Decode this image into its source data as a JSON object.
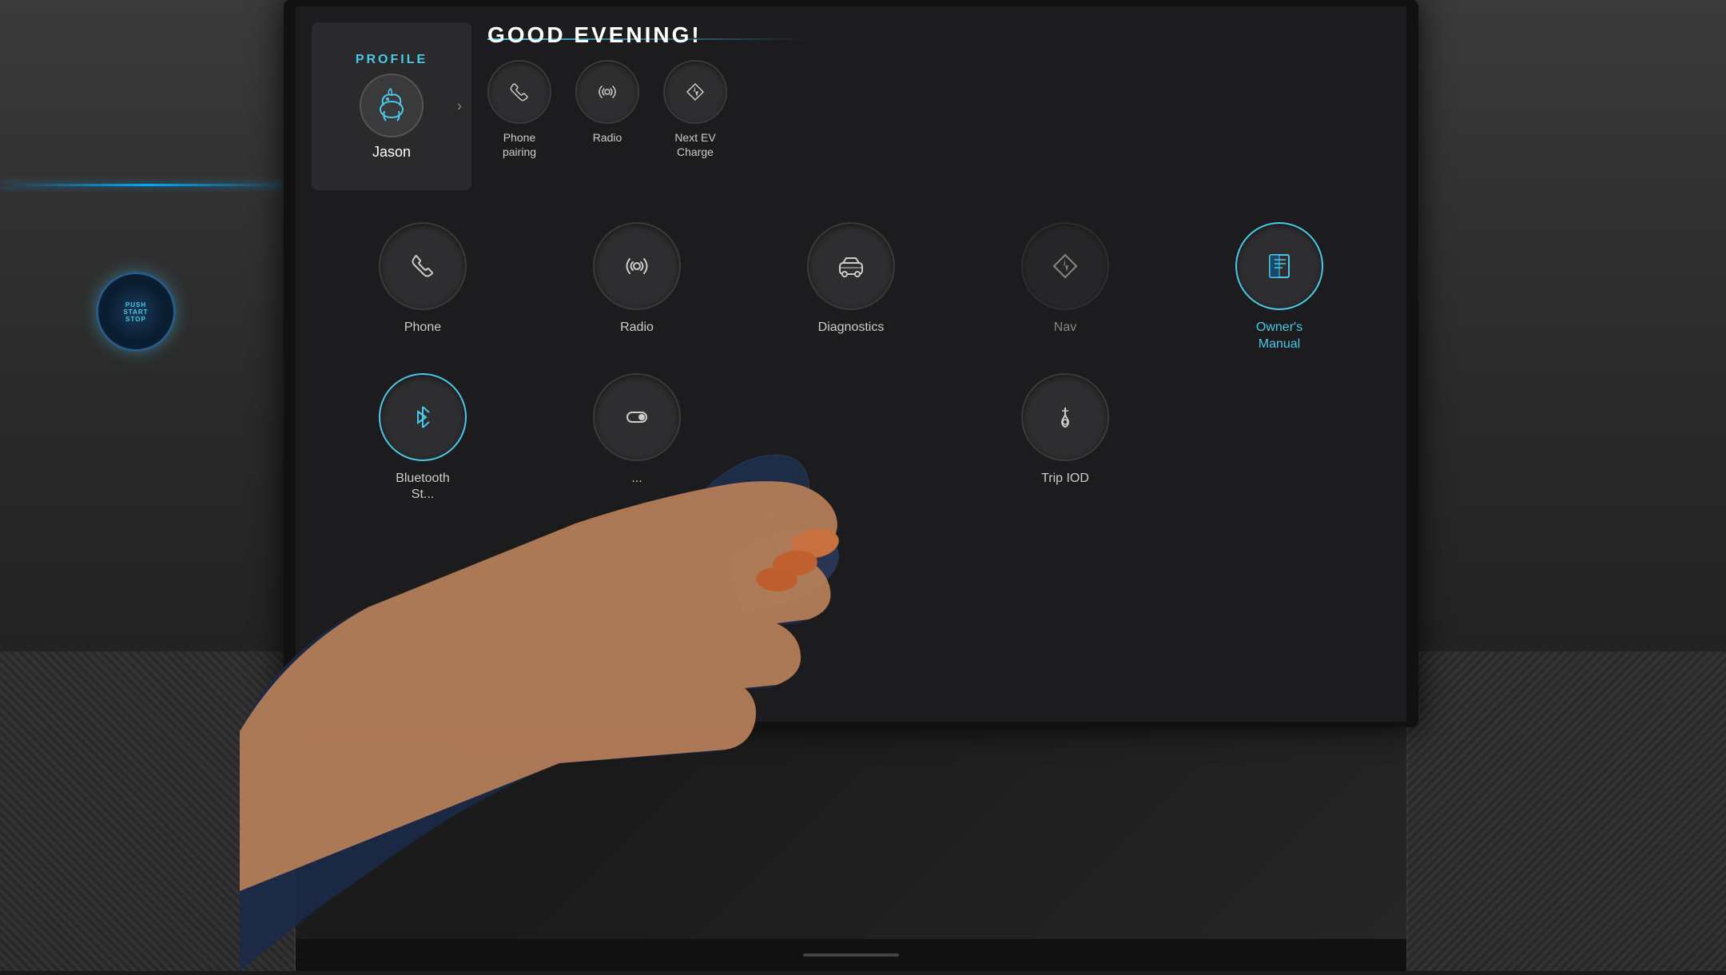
{
  "screen": {
    "greeting": "GOOD EVENING!",
    "profile": {
      "label": "PROFILE",
      "name": "Jason",
      "avatar_icon": "🐎"
    },
    "quick_actions": [
      {
        "id": "phone-pairing",
        "label": "Phone\npairing",
        "icon": "phone"
      },
      {
        "id": "radio",
        "label": "Radio",
        "icon": "radio"
      },
      {
        "id": "next-ev",
        "label": "Next EV\nCharge",
        "icon": "nav"
      }
    ],
    "app_grid_row1": [
      {
        "id": "phone",
        "label": "Phone",
        "icon": "phone"
      },
      {
        "id": "radio",
        "label": "Radio",
        "icon": "radio"
      },
      {
        "id": "diagnostics",
        "label": "Diagnostics",
        "icon": "car"
      },
      {
        "id": "nav",
        "label": "Nav",
        "icon": "nav"
      },
      {
        "id": "owners-manual",
        "label": "Owner's\nManual",
        "icon": "book"
      }
    ],
    "app_grid_row2": [
      {
        "id": "bluetooth",
        "label": "Bluetooth\nSt...",
        "icon": "bluetooth",
        "active": true
      },
      {
        "id": "settings",
        "label": "...",
        "icon": "toggle"
      },
      {
        "id": "trip-iod",
        "label": "Trip IOD",
        "icon": "trip"
      }
    ]
  },
  "colors": {
    "accent": "#4ac8e8",
    "background": "#1c1c1e",
    "panel": "#2e2e30",
    "text_primary": "#ffffff",
    "text_secondary": "#cccccc"
  }
}
